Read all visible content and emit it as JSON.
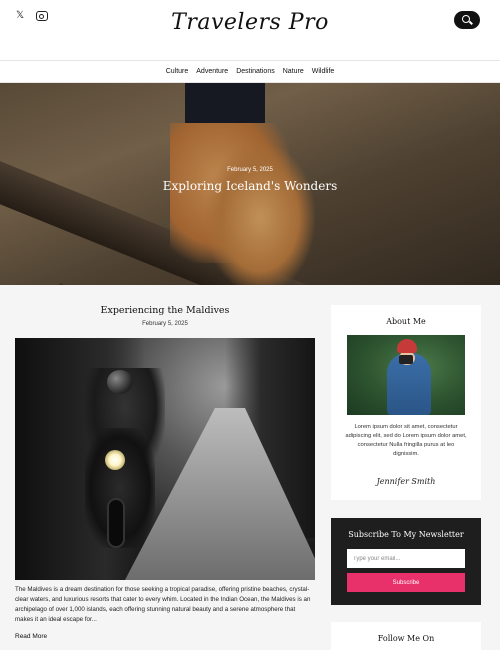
{
  "header": {
    "logo": "Travelers Pro",
    "social_icons": [
      "x-icon",
      "instagram-icon"
    ],
    "search_icon": "search-icon"
  },
  "nav": {
    "items": [
      "Culture",
      "Adventure",
      "Destinations",
      "Nature",
      "Wildlife"
    ]
  },
  "hero": {
    "date": "February 5, 2025",
    "title": "Exploring Iceland's Wonders"
  },
  "post": {
    "title": "Experiencing the Maldives",
    "date": "February 5, 2025",
    "excerpt": "The Maldives is a dream destination for those seeking a tropical paradise, offering pristine beaches, crystal-clear waters, and luxurious resorts that cater to every whim. Located in the Indian Ocean, the Maldives is an archipelago of over 1,000 islands, each offering stunning natural beauty and a serene atmosphere that makes it an ideal escape for...",
    "read_more": "Read More"
  },
  "sidebar": {
    "about": {
      "title": "About Me",
      "text": "Lorem ipsum dolor sit amet, consectetur adipiscing elit, sed do Lorem ipsum dolor amet, consectetur Nulla fringilla purus at leo dignissim.",
      "signature": "Jennifer Smith"
    },
    "newsletter": {
      "title": "Subscribe To My Newsletter",
      "placeholder": "Type your email...",
      "button": "Subscribe"
    },
    "follow": {
      "title": "Follow Me On"
    }
  },
  "colors": {
    "accent": "#e8306a",
    "dark": "#1e1e1e",
    "background": "#f5f5f5"
  }
}
